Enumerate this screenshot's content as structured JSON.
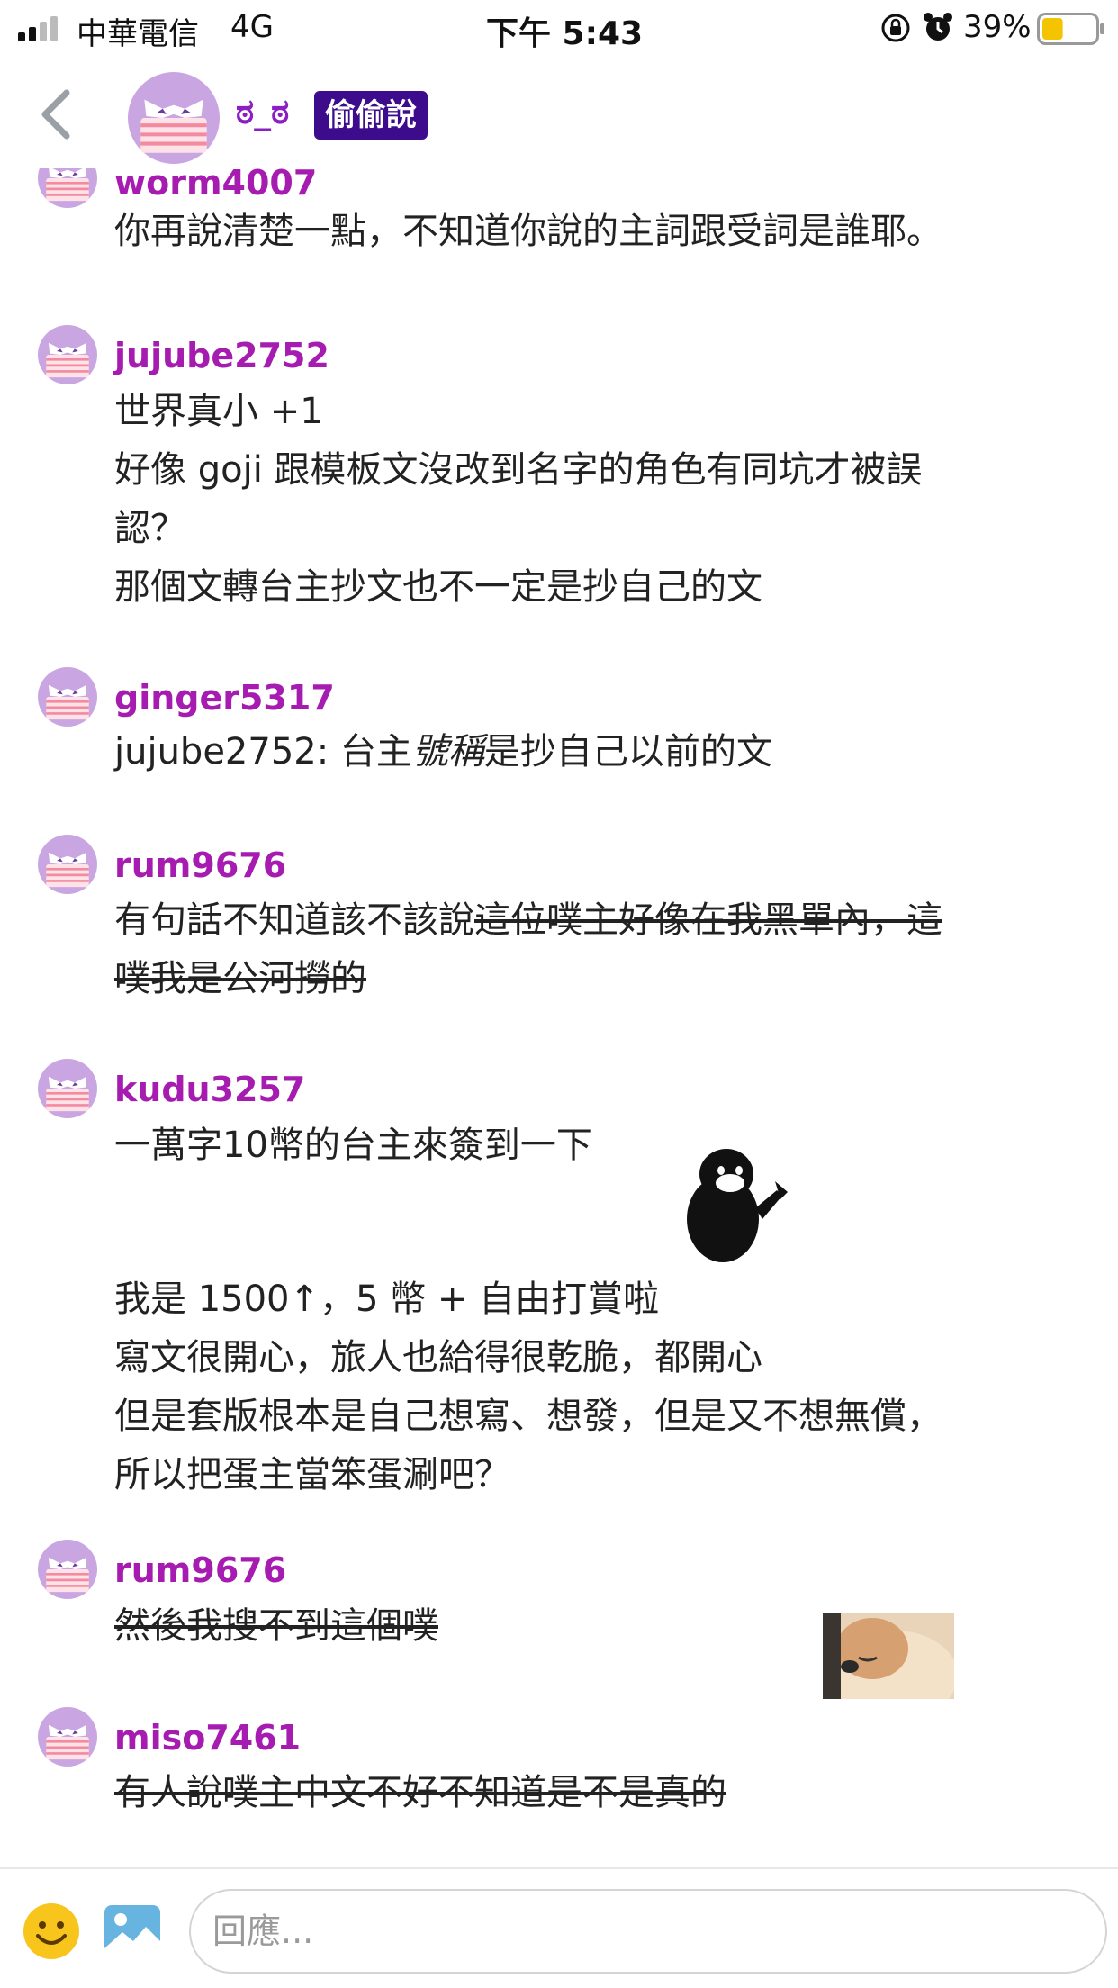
{
  "status_bar": {
    "carrier": "中華電信",
    "network": "4G",
    "time": "下午 5:43",
    "battery_percent": "39%",
    "battery_level": 0.39
  },
  "header": {
    "back_icon": "chevron-left-icon",
    "plurk_owner_name": "ಠ_ಠ",
    "anonymous_tag": "偷偷說"
  },
  "responses": [
    {
      "username": "worm4007",
      "lines": [
        [
          "你再說清楚一點，不知道你說的主詞跟受詞是誰耶。"
        ]
      ]
    },
    {
      "username": "jujube2752",
      "lines": [
        [
          "世界真小 +1"
        ],
        [
          "好像 goji 跟模板文沒改到名字的角色有同坑才被誤"
        ],
        [
          "認？"
        ],
        [
          "那個文轉台主抄文也不一定是抄自己的文"
        ]
      ]
    },
    {
      "username": "ginger5317",
      "line_parts": [
        "jujube2752: 台主",
        "號稱",
        "是抄自己以前的文"
      ]
    },
    {
      "username": "rum9676",
      "line_parts": [
        "有句話不知道該不該說",
        "這位噗主好像在我黑單內，這",
        "噗我是公河撈的"
      ]
    },
    {
      "username": "kudu3257",
      "lines": [
        [
          "一萬字10幣的台主來簽到一下"
        ],
        [
          "我是 1500↑，5 幣 + 自由打賞啦"
        ],
        [
          "寫文很開心，旅人也給得很乾脆，都開心"
        ],
        [
          "但是套版根本是自己想寫、想發，但是又不想無償，"
        ],
        [
          "所以把蛋主當笨蛋涮吧？"
        ]
      ],
      "sticker": "penguin-sticker"
    },
    {
      "username": "rum9676",
      "strike_text": "然後我搜不到這個噗"
    },
    {
      "username": "miso7461",
      "strike_text": "有人說噗主中文不好不知道是不是真的",
      "image": "sleepy-dog-image"
    }
  ],
  "composer": {
    "placeholder": "回應...",
    "emoji_icon": "smiley-icon",
    "image_icon": "image-icon"
  },
  "colors": {
    "username": "#a61bb0",
    "owner_name": "#8b1fc4",
    "tag_bg": "#3d0c8c",
    "avatar_purple": "#c7a6e0",
    "avatar_mask": "#f4b8c2"
  }
}
